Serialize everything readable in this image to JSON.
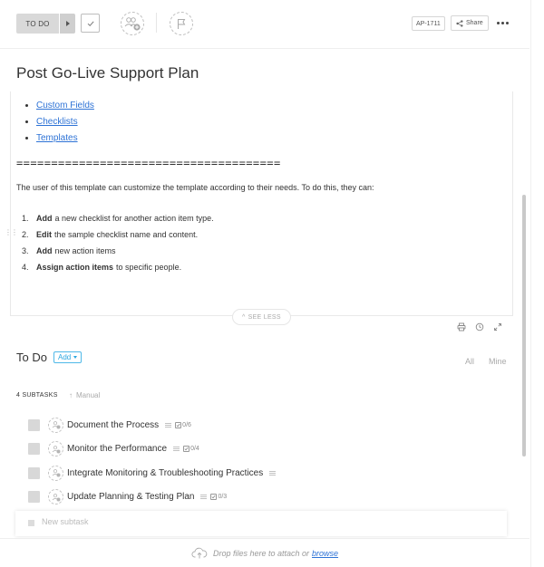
{
  "toolbar": {
    "status_label": "TO DO",
    "task_id": "AP-1711",
    "share_label": "Share"
  },
  "task": {
    "title": "Post Go-Live Support Plan"
  },
  "description": {
    "links": [
      "Custom Fields",
      "Checklists",
      "Templates"
    ],
    "divider": "======================================",
    "intro": "The user of this template can customize the template according to their needs. To do this, they can:",
    "steps": [
      {
        "num": "1.",
        "bold": "Add",
        "text": "a new checklist for another action item type."
      },
      {
        "num": "2.",
        "bold": "Edit",
        "text": "the sample checklist name and content."
      },
      {
        "num": "3.",
        "bold": "Add",
        "text": "new action items"
      },
      {
        "num": "4.",
        "bold": "Assign action items",
        "text": "to specific people."
      }
    ],
    "see_less_label": "SEE LESS"
  },
  "todo": {
    "label": "To Do",
    "add_label": "Add",
    "filter_all": "All",
    "filter_mine": "Mine",
    "subtask_count": "4 SUBTASKS",
    "sort_label": "Manual",
    "subtasks": [
      {
        "name": "Document the Process",
        "checklist": "0/6"
      },
      {
        "name": "Monitor the Performance",
        "checklist": "0/4"
      },
      {
        "name": "Integrate Monitoring & Troubleshooting Practices",
        "checklist": ""
      },
      {
        "name": "Update Planning & Testing Plan",
        "checklist": "0/3"
      }
    ],
    "new_subtask_placeholder": "New subtask"
  },
  "footer": {
    "drop_text": "Drop files here to attach or",
    "browse_label": "browse"
  },
  "colors": {
    "link": "#2e73d6",
    "accent": "#2aa6e0",
    "status_bg": "#d9d9d9"
  }
}
